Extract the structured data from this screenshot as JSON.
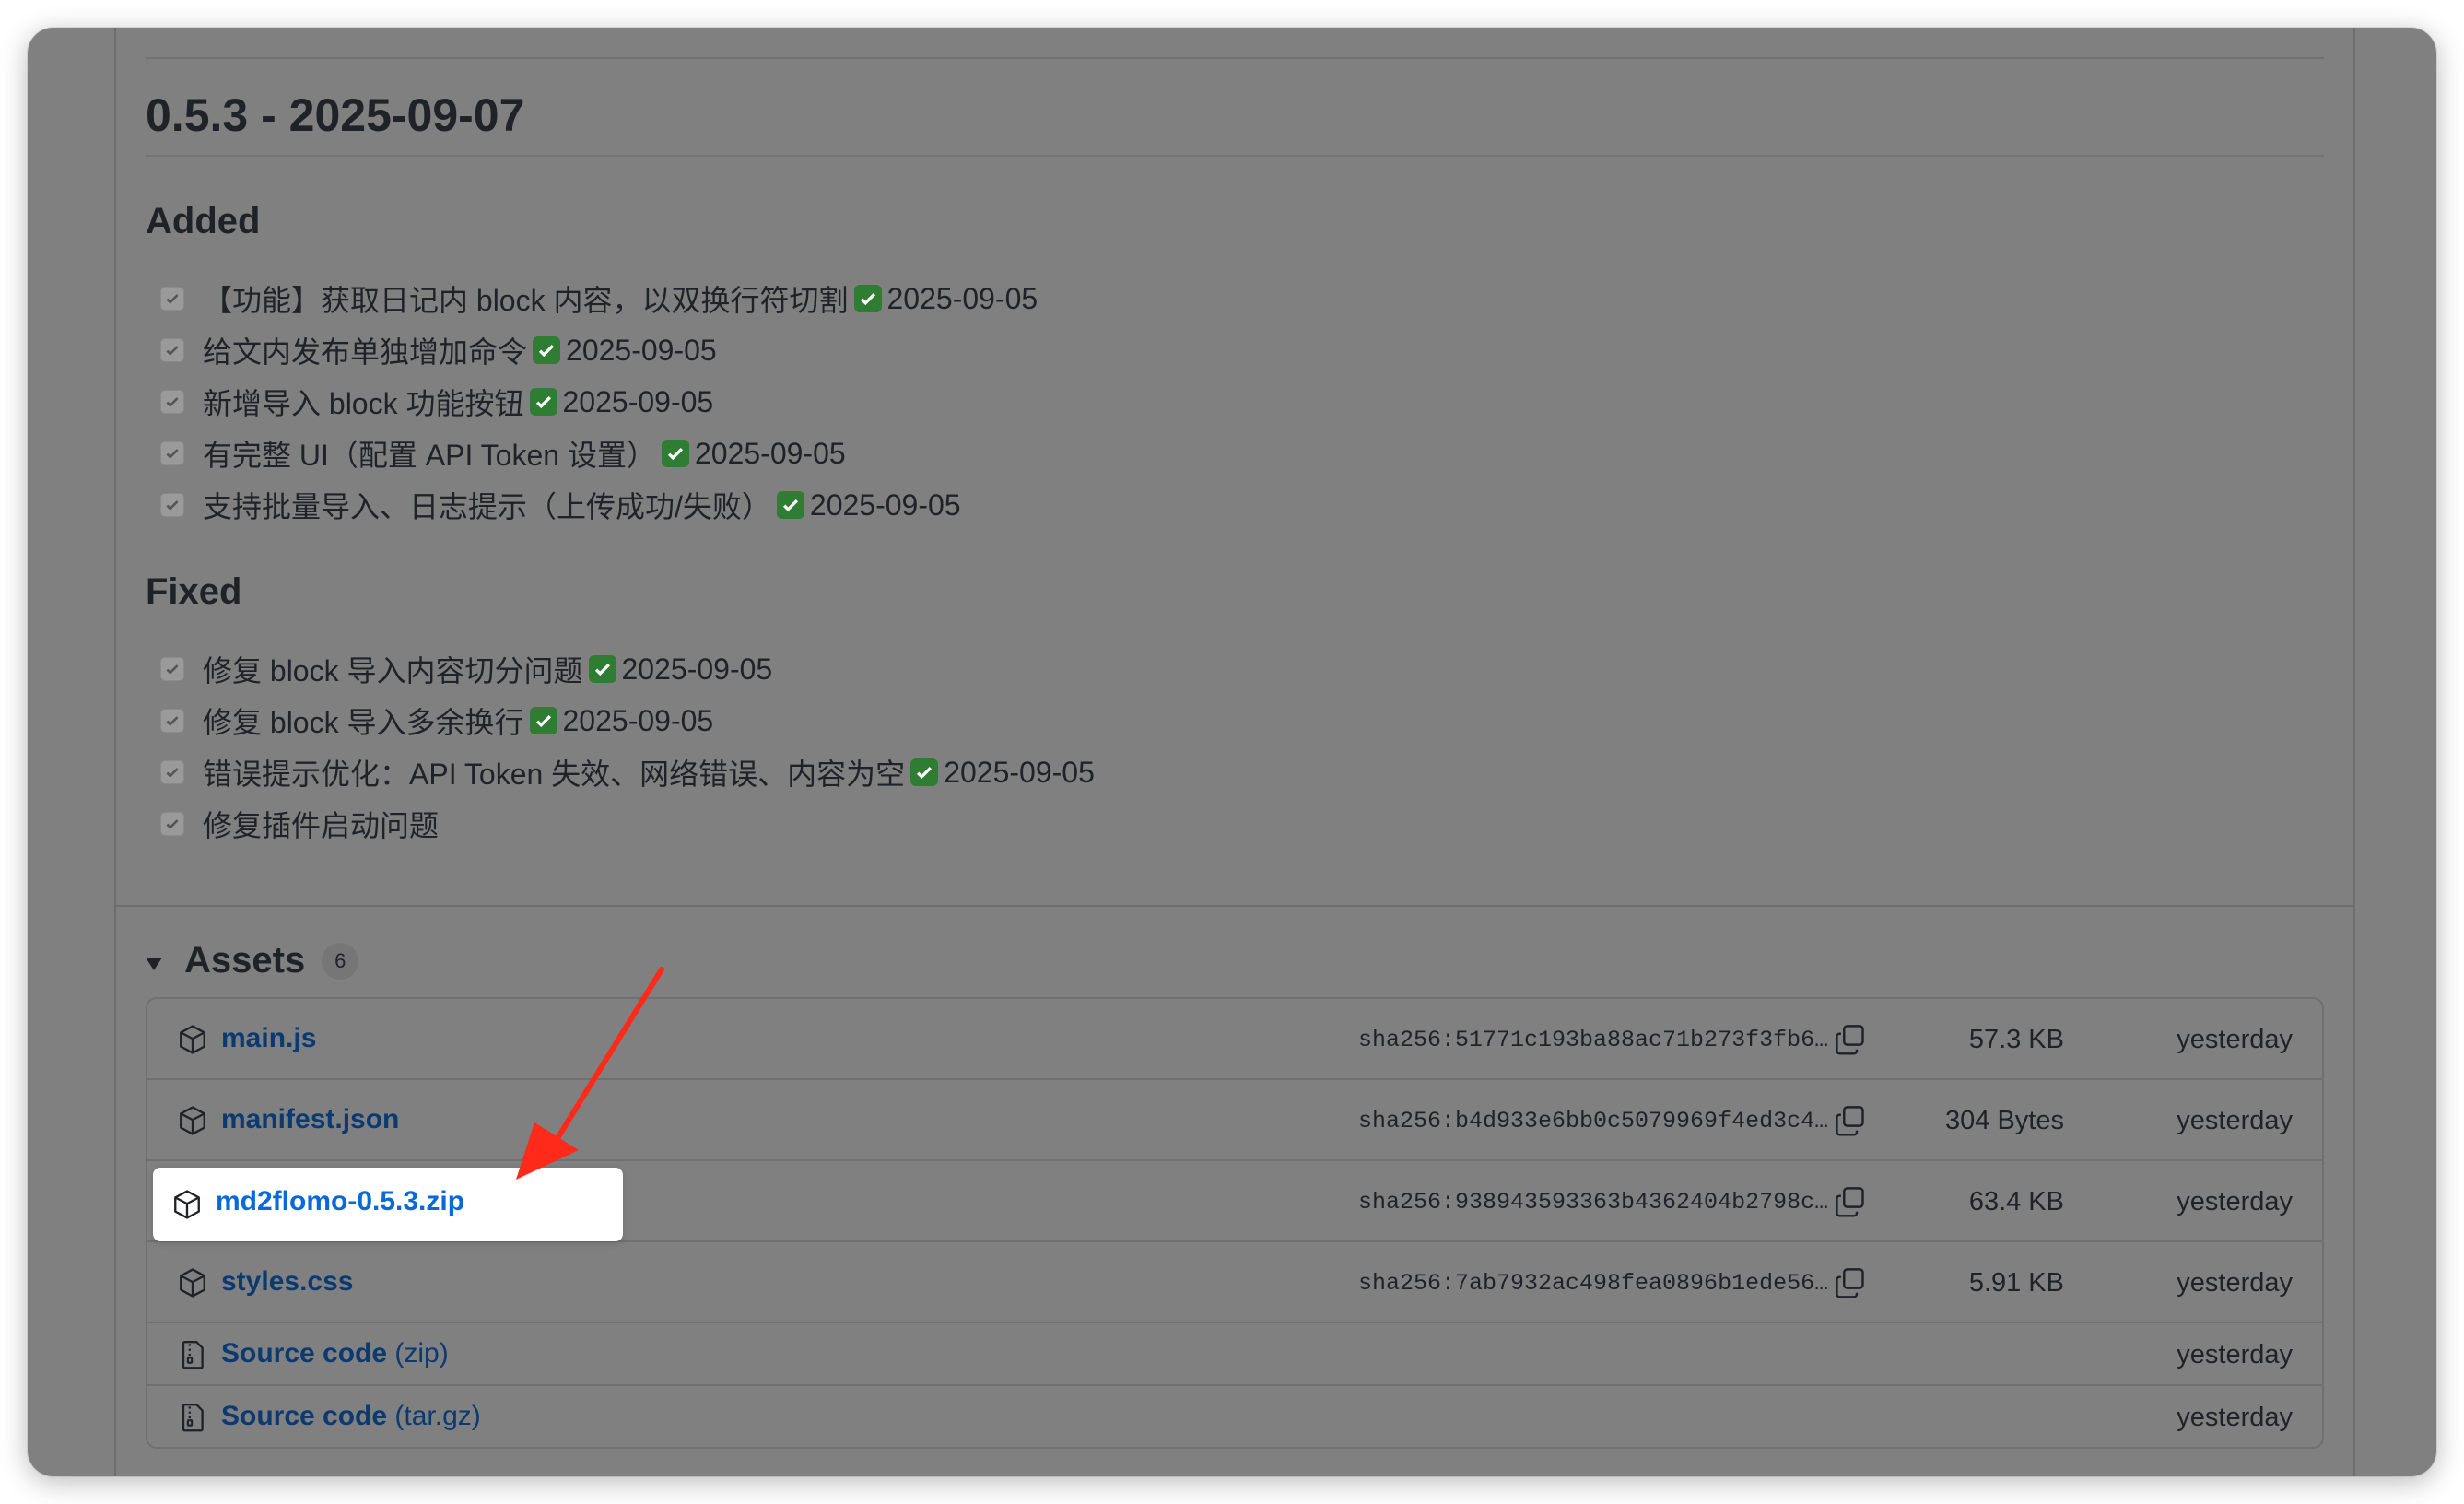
{
  "release": {
    "version_heading": "0.5.3 - 2025-09-07",
    "sections": [
      {
        "heading": "Added",
        "items": [
          {
            "text": "【功能】获取日记内 block 内容，以双换行符切割",
            "done": true,
            "date": "2025-09-05"
          },
          {
            "text": "给文内发布单独增加命令",
            "done": true,
            "date": "2025-09-05"
          },
          {
            "text": "新增导入 block 功能按钮",
            "done": true,
            "date": "2025-09-05"
          },
          {
            "text": "有完整 UI（配置 API Token 设置）",
            "done": true,
            "date": "2025-09-05"
          },
          {
            "text": "支持批量导入、日志提示（上传成功/失败）",
            "done": true,
            "date": "2025-09-05"
          }
        ]
      },
      {
        "heading": "Fixed",
        "items": [
          {
            "text": "修复 block 导入内容切分问题",
            "done": true,
            "date": "2025-09-05"
          },
          {
            "text": "修复 block 导入多余换行",
            "done": true,
            "date": "2025-09-05"
          },
          {
            "text": "错误提示优化：API Token 失效、网络错误、内容为空",
            "done": true,
            "date": "2025-09-05"
          },
          {
            "text": "修复插件启动问题",
            "done": false,
            "date": ""
          }
        ]
      }
    ]
  },
  "assets": {
    "title": "Assets",
    "count": "6",
    "rows": [
      {
        "name": "main.js",
        "hash": "sha256:51771c193ba88ac71b273f3fb6…",
        "size": "57.3 KB",
        "date": "yesterday",
        "icon": "package-icon"
      },
      {
        "name": "manifest.json",
        "hash": "sha256:b4d933e6bb0c5079969f4ed3c4…",
        "size": "304 Bytes",
        "date": "yesterday",
        "icon": "package-icon"
      },
      {
        "name": "md2flomo-0.5.3.zip",
        "hash": "sha256:938943593363b4362404b2798c…",
        "size": "63.4 KB",
        "date": "yesterday",
        "icon": "package-icon"
      },
      {
        "name": "styles.css",
        "hash": "sha256:7ab7932ac498fea0896b1ede56…",
        "size": "5.91 KB",
        "date": "yesterday",
        "icon": "package-icon"
      },
      {
        "name": "Source code",
        "suffix": "(zip)",
        "date": "yesterday",
        "icon": "file-zip-icon"
      },
      {
        "name": "Source code",
        "suffix": "(tar.gz)",
        "date": "yesterday",
        "icon": "file-zip-icon"
      }
    ]
  },
  "colors": {
    "overlay": "#808080",
    "link": "#0b3a73",
    "link_highlight": "#0969da",
    "done_green": "#2e7d32",
    "arrow_red": "#ff2a1a"
  }
}
